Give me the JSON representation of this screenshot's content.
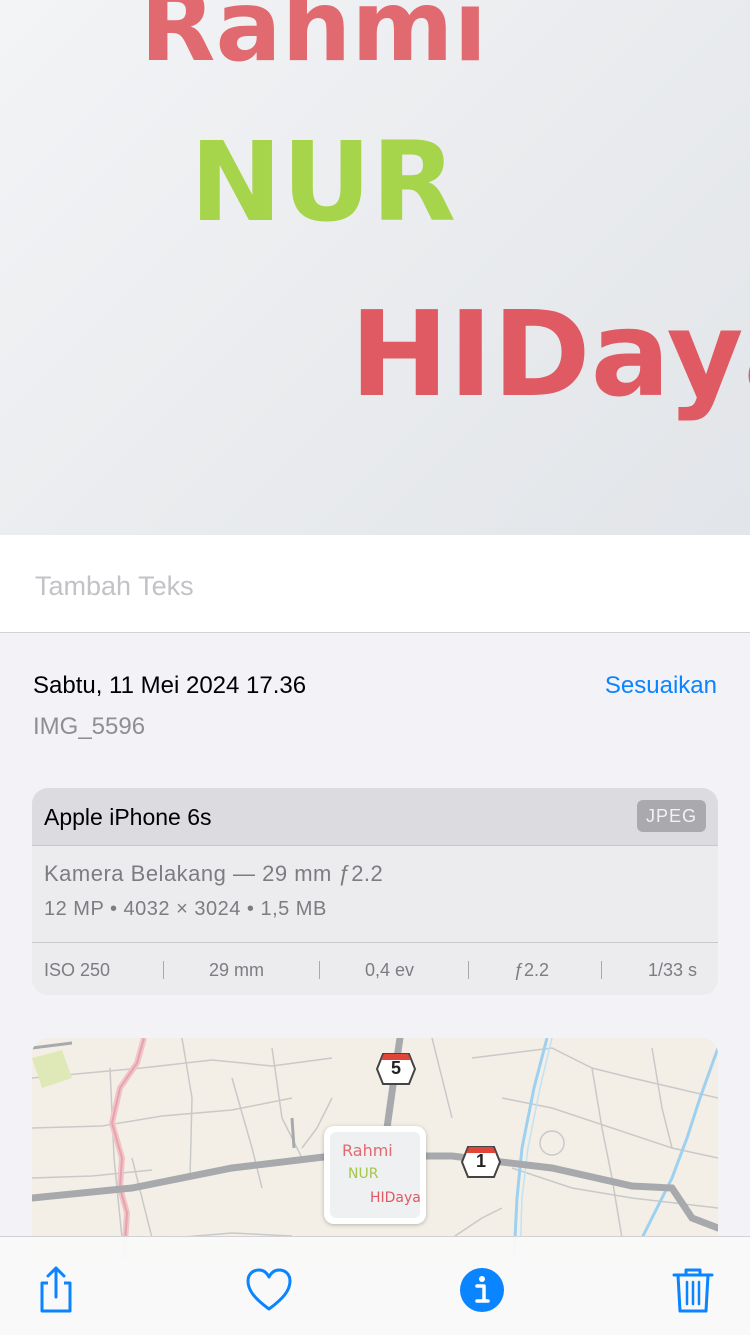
{
  "photo": {
    "handwriting": [
      "Rahmi",
      "NUR",
      "HIDaya"
    ]
  },
  "caption": {
    "placeholder": "Tambah Teks"
  },
  "meta": {
    "date": "Sabtu, 11 Mei 2024 17.36",
    "adjust_label": "Sesuaikan",
    "filename": "IMG_5596"
  },
  "camera": {
    "device": "Apple iPhone 6s",
    "format": "JPEG",
    "lens": "Kamera Belakang — 29 mm ƒ2.2",
    "specs": "12 MP  •  4032 × 3024  •  1,5 MB",
    "exif": {
      "iso": "ISO 250",
      "focal": "29 mm",
      "ev": "0,4 ev",
      "aperture": "ƒ2.2",
      "shutter": "1/33 s"
    }
  },
  "map": {
    "route_badges": [
      "5",
      "1"
    ],
    "thumb_text": [
      "Rahmi",
      "NUR",
      "HIDaya"
    ]
  },
  "toolbar": {
    "icons": [
      "share-icon",
      "heart-icon",
      "info-icon",
      "trash-icon"
    ],
    "accent": "#0a84ff"
  }
}
